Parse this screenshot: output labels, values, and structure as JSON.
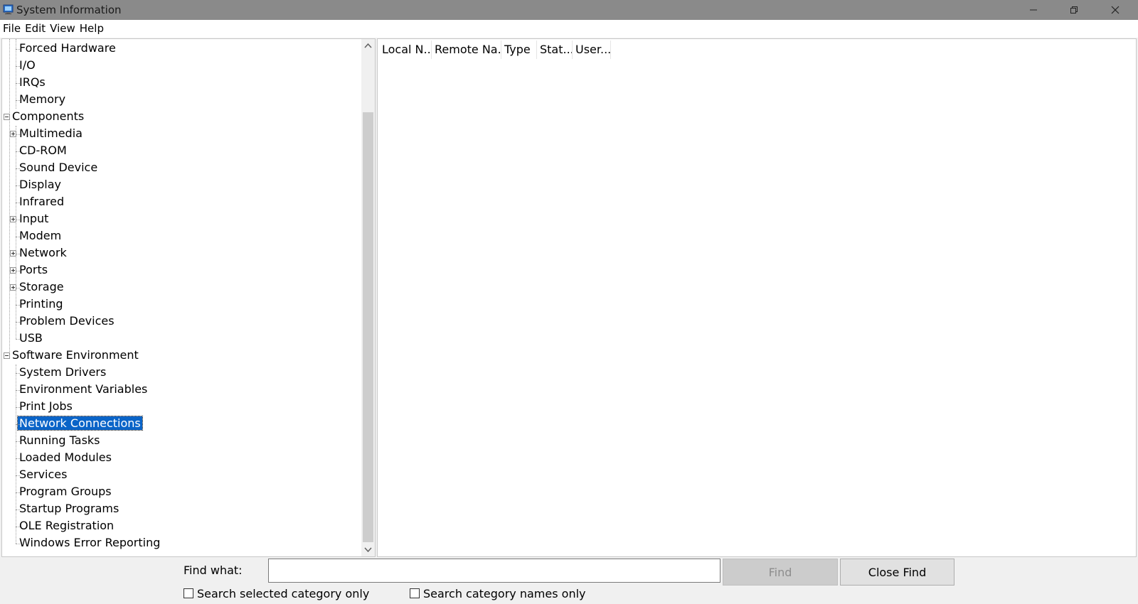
{
  "window": {
    "title": "System Information",
    "icon": "system-info-icon"
  },
  "menu": [
    "File",
    "Edit",
    "View",
    "Help"
  ],
  "tree": {
    "items": [
      {
        "label": "Forced Hardware",
        "level": 1,
        "expander": "none"
      },
      {
        "label": "I/O",
        "level": 1,
        "expander": "none"
      },
      {
        "label": "IRQs",
        "level": 1,
        "expander": "none"
      },
      {
        "label": "Memory",
        "level": 1,
        "expander": "none"
      },
      {
        "label": "Components",
        "level": 0,
        "expander": "minus"
      },
      {
        "label": "Multimedia",
        "level": 1,
        "expander": "plus"
      },
      {
        "label": "CD-ROM",
        "level": 1,
        "expander": "none"
      },
      {
        "label": "Sound Device",
        "level": 1,
        "expander": "none"
      },
      {
        "label": "Display",
        "level": 1,
        "expander": "none"
      },
      {
        "label": "Infrared",
        "level": 1,
        "expander": "none"
      },
      {
        "label": "Input",
        "level": 1,
        "expander": "plus"
      },
      {
        "label": "Modem",
        "level": 1,
        "expander": "none"
      },
      {
        "label": "Network",
        "level": 1,
        "expander": "plus"
      },
      {
        "label": "Ports",
        "level": 1,
        "expander": "plus"
      },
      {
        "label": "Storage",
        "level": 1,
        "expander": "plus"
      },
      {
        "label": "Printing",
        "level": 1,
        "expander": "none"
      },
      {
        "label": "Problem Devices",
        "level": 1,
        "expander": "none"
      },
      {
        "label": "USB",
        "level": 1,
        "expander": "none"
      },
      {
        "label": "Software Environment",
        "level": 0,
        "expander": "minus"
      },
      {
        "label": "System Drivers",
        "level": 1,
        "expander": "none"
      },
      {
        "label": "Environment Variables",
        "level": 1,
        "expander": "none"
      },
      {
        "label": "Print Jobs",
        "level": 1,
        "expander": "none"
      },
      {
        "label": "Network Connections",
        "level": 1,
        "expander": "none",
        "selected": true
      },
      {
        "label": "Running Tasks",
        "level": 1,
        "expander": "none"
      },
      {
        "label": "Loaded Modules",
        "level": 1,
        "expander": "none"
      },
      {
        "label": "Services",
        "level": 1,
        "expander": "none"
      },
      {
        "label": "Program Groups",
        "level": 1,
        "expander": "none"
      },
      {
        "label": "Startup Programs",
        "level": 1,
        "expander": "none"
      },
      {
        "label": "OLE Registration",
        "level": 1,
        "expander": "none"
      },
      {
        "label": "Windows Error Reporting",
        "level": 1,
        "expander": "none"
      }
    ]
  },
  "details": {
    "columns": [
      "Local N...",
      "Remote Na...",
      "Type",
      "Stat...",
      "User..."
    ]
  },
  "find": {
    "label": "Find what:",
    "value": "",
    "find_button": "Find",
    "close_button": "Close Find",
    "check_selected": "Search selected category only",
    "check_names": "Search category names only"
  },
  "colors": {
    "titlebar": "#8a8a8a",
    "selection": "#0a64c8"
  }
}
